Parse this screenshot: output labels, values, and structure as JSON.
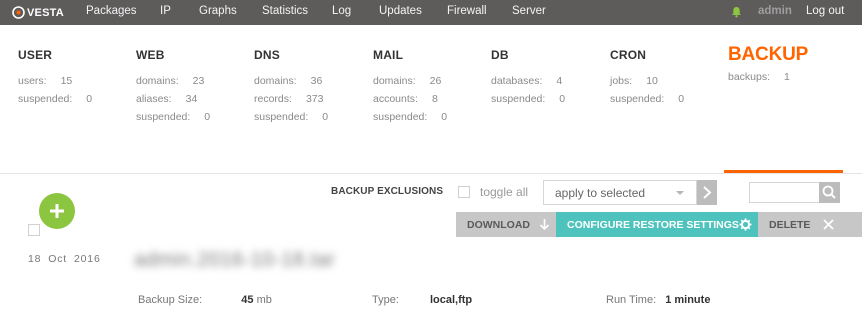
{
  "logo": {
    "text": "VESTA",
    "icon": "vesta-logo-icon"
  },
  "nav": {
    "items": [
      {
        "label": "Packages"
      },
      {
        "label": "IP"
      },
      {
        "label": "Graphs"
      },
      {
        "label": "Statistics"
      },
      {
        "label": "Log"
      },
      {
        "label": "Updates"
      },
      {
        "label": "Firewall"
      },
      {
        "label": "Server"
      }
    ],
    "bell_icon": "bell-icon",
    "user": "admin",
    "logout": "Log out"
  },
  "stats": [
    {
      "title": "USER",
      "rows": [
        {
          "label": "users:",
          "value": "15"
        },
        {
          "label": "suspended:",
          "value": "0"
        }
      ]
    },
    {
      "title": "WEB",
      "rows": [
        {
          "label": "domains:",
          "value": "23"
        },
        {
          "label": "aliases:",
          "value": "34"
        },
        {
          "label": "suspended:",
          "value": "0"
        }
      ]
    },
    {
      "title": "DNS",
      "rows": [
        {
          "label": "domains:",
          "value": "36"
        },
        {
          "label": "records:",
          "value": "373"
        },
        {
          "label": "suspended:",
          "value": "0"
        }
      ]
    },
    {
      "title": "MAIL",
      "rows": [
        {
          "label": "domains:",
          "value": "26"
        },
        {
          "label": "accounts:",
          "value": "8"
        },
        {
          "label": "suspended:",
          "value": "0"
        }
      ]
    },
    {
      "title": "DB",
      "rows": [
        {
          "label": "databases:",
          "value": "4"
        },
        {
          "label": "suspended:",
          "value": "0"
        }
      ]
    },
    {
      "title": "CRON",
      "rows": [
        {
          "label": "jobs:",
          "value": "10"
        },
        {
          "label": "suspended:",
          "value": "0"
        }
      ]
    },
    {
      "title": "BACKUP",
      "rows": [
        {
          "label": "backups:",
          "value": "1"
        }
      ],
      "active": true
    }
  ],
  "toolbar": {
    "exclusions": "BACKUP EXCLUSIONS",
    "toggle_all": "toggle all",
    "bulk_select": "apply to selected",
    "apply_icon": "chevron-right-icon",
    "search_icon": "search-icon"
  },
  "add_icon": "plus-icon",
  "backup": {
    "date": {
      "day": "18",
      "month": "Oct",
      "year": "2016"
    },
    "name": "admin.2016-10-18.tar",
    "actions": {
      "download": "DOWNLOAD",
      "download_icon": "download-arrow-icon",
      "configure": "CONFIGURE RESTORE SETTINGS",
      "configure_icon": "gear-icon",
      "delete": "DELETE",
      "delete_icon": "close-icon"
    },
    "size_label": "Backup Size:",
    "size_value": "45",
    "size_unit": "mb",
    "type_label": "Type:",
    "type_value": "local,ftp",
    "runtime_label": "Run Time:",
    "runtime_value": "1 minute"
  },
  "colors": {
    "nav_bg": "#5e5b5b",
    "accent_backup": "#ff6400",
    "add_green": "#8cc540",
    "configure_teal": "#4ec3bd",
    "action_gray": "#c7c7c7"
  }
}
